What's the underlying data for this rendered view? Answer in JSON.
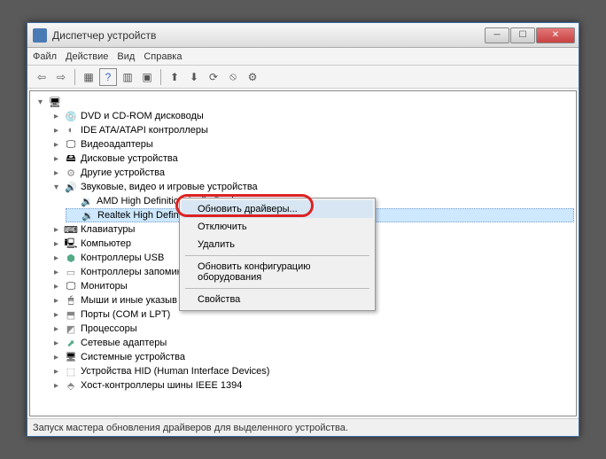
{
  "window": {
    "title": "Диспетчер устройств"
  },
  "menu": {
    "file": "Файл",
    "action": "Действие",
    "view": "Вид",
    "help": "Справка"
  },
  "tree": {
    "root_expanded": "▾",
    "items": [
      {
        "toggle": "▸",
        "icon": "ic-disc",
        "label": "DVD и CD-ROM дисководы"
      },
      {
        "toggle": "▸",
        "icon": "ic-ide",
        "label": "IDE ATA/ATAPI контроллеры"
      },
      {
        "toggle": "▸",
        "icon": "ic-video",
        "label": "Видеоадаптеры"
      },
      {
        "toggle": "▸",
        "icon": "ic-disk",
        "label": "Дисковые устройства"
      },
      {
        "toggle": "▸",
        "icon": "ic-other",
        "label": "Другие устройства"
      },
      {
        "toggle": "▾",
        "icon": "ic-sound",
        "label": "Звуковые, видео и игровые устройства"
      },
      {
        "toggle": "▸",
        "icon": "ic-kbd",
        "label": "Клавиатуры"
      },
      {
        "toggle": "▸",
        "icon": "ic-comp",
        "label": "Компьютер"
      },
      {
        "toggle": "▸",
        "icon": "ic-usb",
        "label": "Контроллеры USB"
      },
      {
        "toggle": "▸",
        "icon": "ic-mem",
        "label": "Контроллеры запомин"
      },
      {
        "toggle": "▸",
        "icon": "ic-mon",
        "label": "Мониторы"
      },
      {
        "toggle": "▸",
        "icon": "ic-mouse",
        "label": "Мыши и иные указыв"
      },
      {
        "toggle": "▸",
        "icon": "ic-port",
        "label": "Порты (COM и LPT)"
      },
      {
        "toggle": "▸",
        "icon": "ic-cpu",
        "label": "Процессоры"
      },
      {
        "toggle": "▸",
        "icon": "ic-net",
        "label": "Сетевые адаптеры"
      },
      {
        "toggle": "▸",
        "icon": "ic-sys",
        "label": "Системные устройства"
      },
      {
        "toggle": "▸",
        "icon": "ic-hid",
        "label": "Устройства HID (Human Interface Devices)"
      },
      {
        "toggle": "▸",
        "icon": "ic-1394",
        "label": "Хост-контроллеры шины IEEE 1394"
      }
    ],
    "sound_children": [
      {
        "icon": "ic-audio",
        "label": "AMD High Definition Audio Device"
      },
      {
        "icon": "ic-audio",
        "label": "Realtek High Definiti",
        "selected": true
      }
    ]
  },
  "ctx": {
    "update": "Обновить драйверы...",
    "disable": "Отключить",
    "delete": "Удалить",
    "refresh": "Обновить конфигурацию оборудования",
    "props": "Свойства"
  },
  "status": "Запуск мастера обновления драйверов для выделенного устройства."
}
